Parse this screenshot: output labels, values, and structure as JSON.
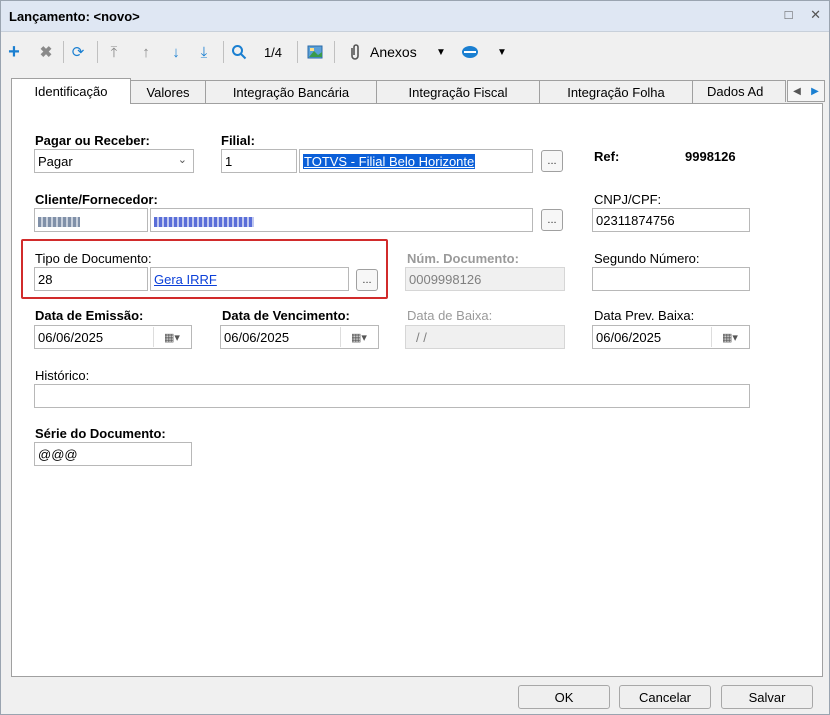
{
  "window": {
    "title": "Lançamento: <novo>",
    "restore_label": "□",
    "close_label": "✕"
  },
  "toolbar": {
    "page_indicator": "1/4",
    "attachments_label": "Anexos",
    "icons": [
      "plus-icon",
      "delete-icon",
      "refresh-icon",
      "first-icon",
      "previous-icon",
      "next-icon",
      "last-icon",
      "search-icon",
      "image-icon",
      "paperclip-icon",
      "settings-icon"
    ]
  },
  "tabs": [
    "Identificação",
    "Valores",
    "Integração Bancária",
    "Integração Fiscal",
    "Integração Folha",
    "Dados Ad"
  ],
  "form": {
    "pagar_receber": {
      "label": "Pagar ou Receber:",
      "value": "Pagar"
    },
    "filial": {
      "label": "Filial:",
      "code": "1",
      "name": "TOTVS - Filial Belo Horizonte"
    },
    "ref": {
      "label": "Ref:",
      "value": "9998126"
    },
    "cliente_fornecedor": {
      "label": "Cliente/Fornecedor:"
    },
    "cnpj_cpf": {
      "label": "CNPJ/CPF:",
      "value": "02311874756"
    },
    "tipo_documento": {
      "label": "Tipo de Documento:",
      "code": "28",
      "name": "Gera IRRF"
    },
    "num_documento": {
      "label": "Núm. Documento:",
      "value": "0009998126"
    },
    "segundo_numero": {
      "label": "Segundo Número:",
      "value": ""
    },
    "data_emissao": {
      "label": "Data de Emissão:",
      "value": "06/06/2025"
    },
    "data_vencimento": {
      "label": "Data de Vencimento:",
      "value": "06/06/2025"
    },
    "data_baixa": {
      "label": "Data de Baixa:",
      "value": "/ /"
    },
    "data_prev_baixa": {
      "label": "Data Prev. Baixa:",
      "value": "06/06/2025"
    },
    "historico": {
      "label": "Histórico:",
      "value": ""
    },
    "serie_documento": {
      "label": "Série do Documento:",
      "value": "@@@"
    },
    "lookup_label": "..."
  },
  "buttons": {
    "ok": "OK",
    "cancel": "Cancelar",
    "save": "Salvar"
  },
  "colors": {
    "accent": "#0b3fd8",
    "highlight": "#d12b2b",
    "titlebar": "#dfe7f3"
  }
}
